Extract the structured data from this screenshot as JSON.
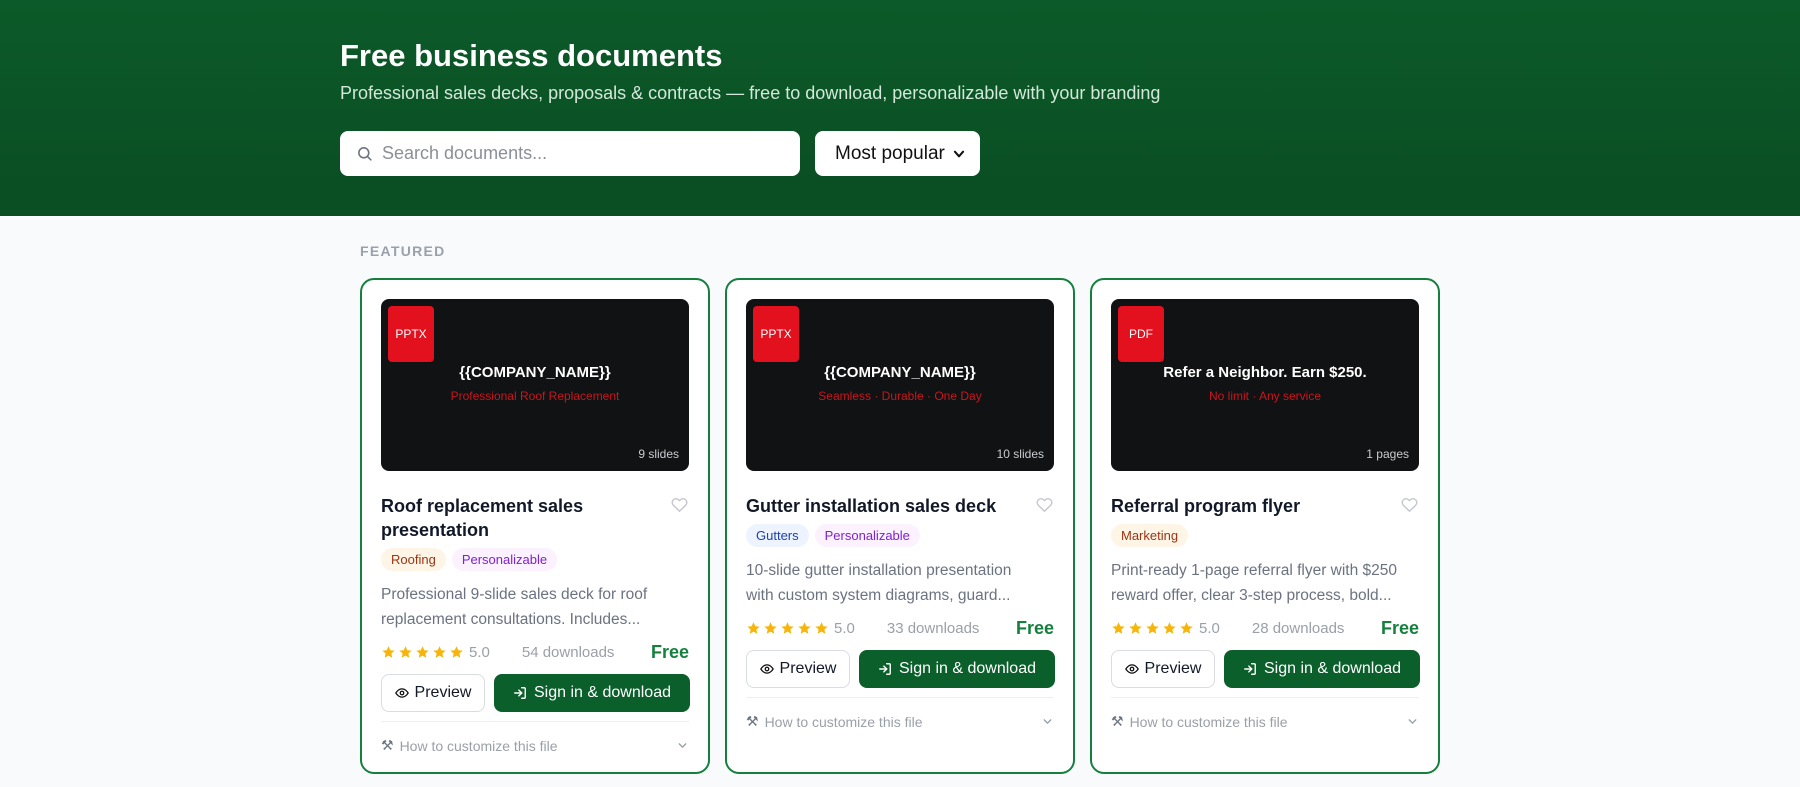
{
  "header": {
    "title": "Free business documents",
    "subtitle": "Professional sales decks, proposals & contracts — free to download, personalizable with your branding",
    "search_placeholder": "Search documents...",
    "sort_selected": "Most popular"
  },
  "section_label": "FEATURED",
  "colors": {
    "brand": "#0b5f2b",
    "hero": "#0c5a29",
    "price": "#15803d",
    "badge": "#e3101e"
  },
  "cards": [
    {
      "badge": "PPTX",
      "thumb_title": "{{COMPANY_NAME}}",
      "thumb_subtitle": "Professional Roof Replacement",
      "thumb_count": "9 slides",
      "title": "Roof replacement sales presentation",
      "tags": [
        "Roofing",
        "Personalizable"
      ],
      "description_line1": "Professional 9-slide sales deck for roof",
      "description_line2": "replacement consultations. Includes...",
      "rating": "5.0",
      "downloads": "54 downloads",
      "price": "Free",
      "preview_label": "Preview",
      "download_label": "Sign in & download",
      "howto_label": "How to customize this file"
    },
    {
      "badge": "PPTX",
      "thumb_title": "{{COMPANY_NAME}}",
      "thumb_subtitle": "Seamless · Durable · One Day",
      "thumb_count": "10 slides",
      "title": "Gutter installation sales deck",
      "tags": [
        "Gutters",
        "Personalizable"
      ],
      "description_line1": "10-slide gutter installation presentation",
      "description_line2": "with custom system diagrams, guard...",
      "rating": "5.0",
      "downloads": "33 downloads",
      "price": "Free",
      "preview_label": "Preview",
      "download_label": "Sign in & download",
      "howto_label": "How to customize this file"
    },
    {
      "badge": "PDF",
      "thumb_title": "Refer a Neighbor. Earn $250.",
      "thumb_subtitle": "No limit · Any service",
      "thumb_count": "1 pages",
      "title": "Referral program flyer",
      "tags": [
        "Marketing"
      ],
      "description_line1": "Print-ready 1-page referral flyer with $250",
      "description_line2": "reward offer, clear 3-step process, bold...",
      "rating": "5.0",
      "downloads": "28 downloads",
      "price": "Free",
      "preview_label": "Preview",
      "download_label": "Sign in & download",
      "howto_label": "How to customize this file"
    }
  ]
}
